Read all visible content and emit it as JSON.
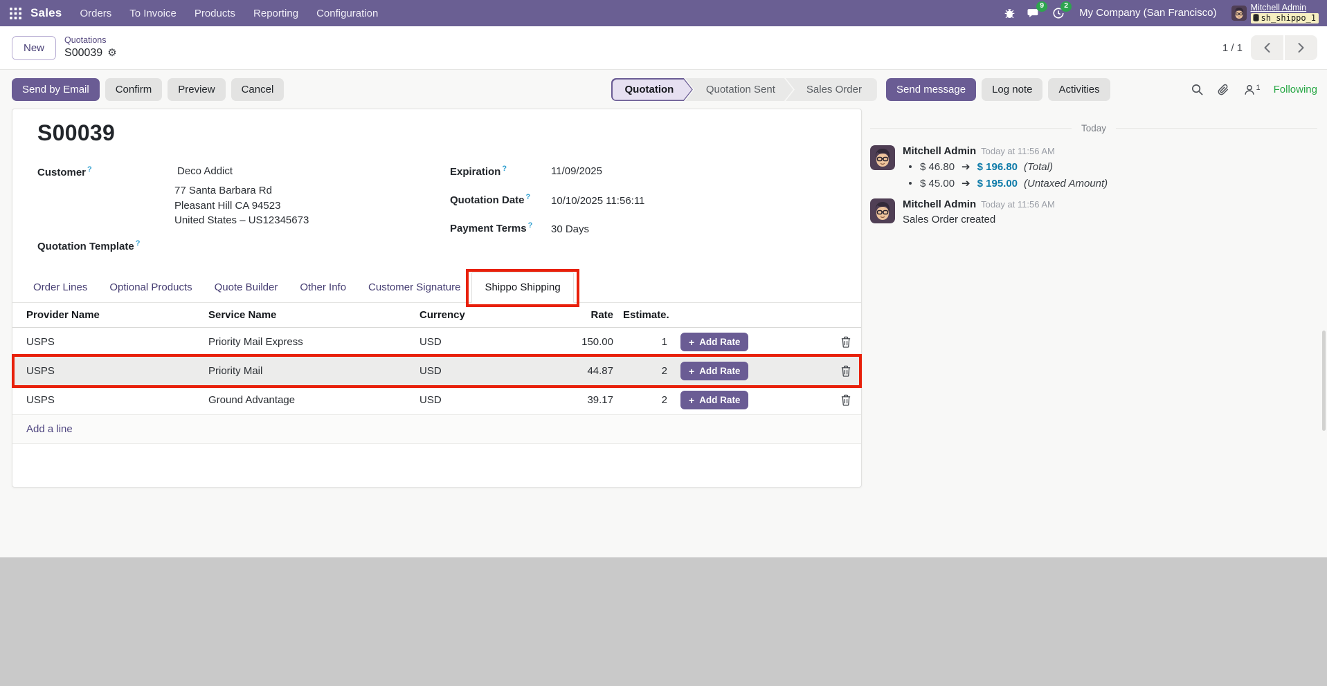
{
  "nav": {
    "app_label": "Sales",
    "items": [
      {
        "label": "Orders"
      },
      {
        "label": "To Invoice"
      },
      {
        "label": "Products"
      },
      {
        "label": "Reporting"
      },
      {
        "label": "Configuration"
      }
    ],
    "chat_badge": "9",
    "activity_badge": "2",
    "company": "My Company (San Francisco)",
    "user_name": "Mitchell Admin",
    "db_name": "sh_shippo_1"
  },
  "breadcrumb": {
    "new_label": "New",
    "parent": "Quotations",
    "current": "S00039",
    "pager": "1 / 1"
  },
  "actions": {
    "send_by_email": "Send by Email",
    "confirm": "Confirm",
    "preview": "Preview",
    "cancel": "Cancel",
    "send_message": "Send message",
    "log_note": "Log note",
    "activities": "Activities",
    "followers_count": "1",
    "following": "Following"
  },
  "statusbar": {
    "steps": [
      {
        "label": "Quotation"
      },
      {
        "label": "Quotation Sent"
      },
      {
        "label": "Sales Order"
      }
    ]
  },
  "form": {
    "title": "S00039",
    "help_marker": "?",
    "customer": {
      "label": "Customer",
      "name": "Deco Addict",
      "address_line1": "77 Santa Barbara Rd",
      "address_line2": "Pleasant Hill CA 94523",
      "address_line3": "United States – US12345673"
    },
    "quotation_template": {
      "label": "Quotation Template"
    },
    "expiration": {
      "label": "Expiration",
      "value": "11/09/2025"
    },
    "quotation_date": {
      "label": "Quotation Date",
      "value": "10/10/2025 11:56:11"
    },
    "payment_terms": {
      "label": "Payment Terms",
      "value": "30 Days"
    }
  },
  "tabs": [
    {
      "label": "Order Lines"
    },
    {
      "label": "Optional Products"
    },
    {
      "label": "Quote Builder"
    },
    {
      "label": "Other Info"
    },
    {
      "label": "Customer Signature"
    },
    {
      "label": "Shippo Shipping"
    }
  ],
  "shipping_table": {
    "headers": {
      "provider": "Provider Name",
      "service": "Service Name",
      "currency": "Currency",
      "rate": "Rate",
      "estimate": "Estimate..."
    },
    "rows": [
      {
        "provider": "USPS",
        "service": "Priority Mail Express",
        "currency": "USD",
        "rate": "150.00",
        "estimate": "1",
        "action": "Add Rate"
      },
      {
        "provider": "USPS",
        "service": "Priority Mail",
        "currency": "USD",
        "rate": "44.87",
        "estimate": "2",
        "action": "Add Rate"
      },
      {
        "provider": "USPS",
        "service": "Ground Advantage",
        "currency": "USD",
        "rate": "39.17",
        "estimate": "2",
        "action": "Add Rate"
      }
    ],
    "add_line": "Add a line"
  },
  "chatter": {
    "date_divider": "Today",
    "messages": [
      {
        "author": "Mitchell Admin",
        "timestamp": "Today at 11:56 AM",
        "changes": [
          {
            "old": "$ 46.80",
            "new": "$ 196.80",
            "field": "(Total)"
          },
          {
            "old": "$ 45.00",
            "new": "$ 195.00",
            "field": "(Untaxed Amount)"
          }
        ]
      },
      {
        "author": "Mitchell Admin",
        "timestamp": "Today at 11:56 AM",
        "body": "Sales Order created"
      }
    ]
  }
}
